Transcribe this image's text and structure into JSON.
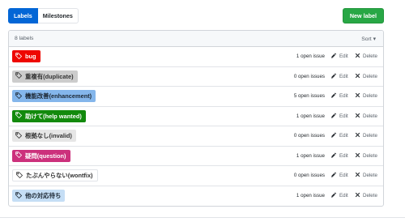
{
  "toolbar": {
    "tabs": [
      {
        "label": "Labels",
        "selected": true
      },
      {
        "label": "Milestones",
        "selected": false
      }
    ],
    "new_label": "New label"
  },
  "header": {
    "count": "8 labels",
    "sort": "Sort ▾"
  },
  "labels": [
    {
      "name": "bug",
      "color": "#ee0701",
      "text_color": "#ffffff",
      "issues": "1 open issue"
    },
    {
      "name": "重複有(duplicate)",
      "color": "#cccccc",
      "text_color": "#333333",
      "issues": "0 open issues"
    },
    {
      "name": "機能改善(enhancement)",
      "color": "#84b6eb",
      "text_color": "#1c2733",
      "issues": "5 open issues"
    },
    {
      "name": "助けて(help wanted)",
      "color": "#128a0c",
      "text_color": "#ffffff",
      "issues": "1 open issue"
    },
    {
      "name": "根拠なし(invalid)",
      "color": "#e6e6e6",
      "text_color": "#333333",
      "issues": "0 open issues"
    },
    {
      "name": "疑問(question)",
      "color": "#cc317c",
      "text_color": "#ffffff",
      "issues": "1 open issue"
    },
    {
      "name": "たぶんやらない(wontfix)",
      "color": "#ffffff",
      "text_color": "#333333",
      "issues": "0 open issues"
    },
    {
      "name": "他の対応待ち",
      "color": "#c5def5",
      "text_color": "#1c2733",
      "issues": "1 open issue"
    }
  ],
  "actions": {
    "edit": "Edit",
    "delete": "Delete"
  }
}
